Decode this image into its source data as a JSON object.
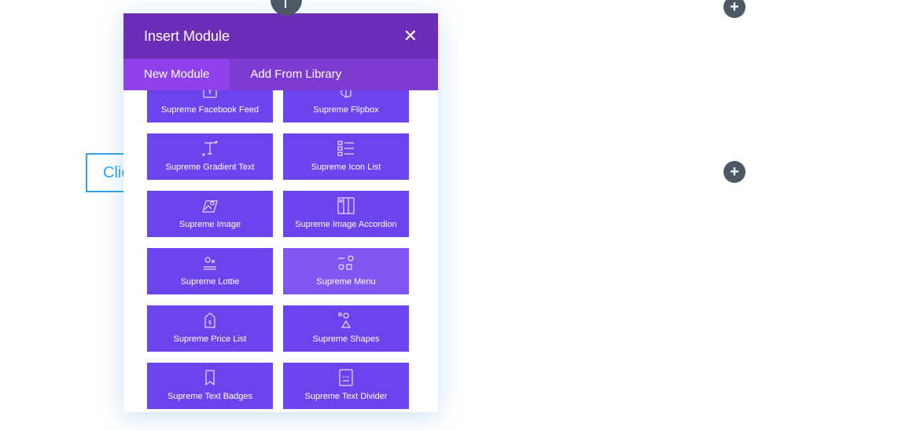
{
  "background": {
    "button_text": "Clic"
  },
  "modal": {
    "title": "Insert Module",
    "close_icon": "close-icon",
    "tabs": [
      {
        "label": "New Module",
        "active": true
      },
      {
        "label": "Add From Library",
        "active": false
      }
    ],
    "modules": [
      {
        "label": "Supreme Facebook Feed",
        "icon": "facebook-feed-icon"
      },
      {
        "label": "Supreme Flipbox",
        "icon": "flipbox-icon"
      },
      {
        "label": "Supreme Gradient Text",
        "icon": "gradient-text-icon"
      },
      {
        "label": "Supreme Icon List",
        "icon": "icon-list-icon"
      },
      {
        "label": "Supreme Image",
        "icon": "image-icon"
      },
      {
        "label": "Supreme Image Accordion",
        "icon": "image-accordion-icon"
      },
      {
        "label": "Supreme Lottie",
        "icon": "lottie-icon"
      },
      {
        "label": "Supreme Menu",
        "icon": "menu-icon"
      },
      {
        "label": "Supreme Price List",
        "icon": "price-list-icon"
      },
      {
        "label": "Supreme Shapes",
        "icon": "shapes-icon"
      },
      {
        "label": "Supreme Text Badges",
        "icon": "text-badges-icon"
      },
      {
        "label": "Supreme Text Divider",
        "icon": "text-divider-icon"
      }
    ]
  },
  "colors": {
    "header": "#6c2eb9",
    "tabs_bar": "#7e3bd0",
    "active_tab": "#8f42ec",
    "tile": "#6c44ee",
    "tile_hover": "#8058f1"
  }
}
